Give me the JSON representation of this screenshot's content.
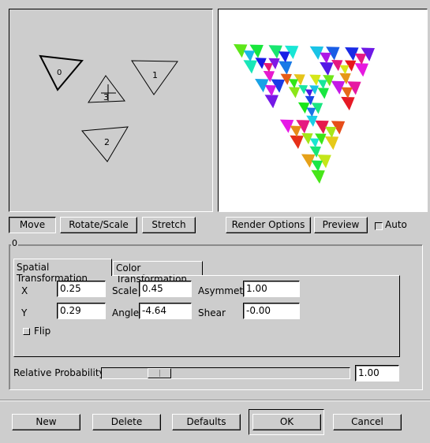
{
  "editor": {
    "triangles": [
      {
        "label": "0",
        "selected": true
      },
      {
        "label": "1"
      },
      {
        "label": "2"
      },
      {
        "label": "3"
      }
    ]
  },
  "toolbar": {
    "move": "Move",
    "rotate_scale": "Rotate/Scale",
    "stretch": "Stretch",
    "render_options": "Render Options",
    "preview": "Preview",
    "auto": "Auto",
    "auto_checked": false,
    "active_mode": "Move"
  },
  "group": {
    "title": "0"
  },
  "tabs": [
    {
      "label": "Spatial Transformation",
      "active": true
    },
    {
      "label": "Color Transformation"
    }
  ],
  "spatial": {
    "x_label": "X",
    "x": "0.25",
    "y_label": "Y",
    "y": "0.29",
    "scale_label": "Scale",
    "scale": "0.45",
    "angle_label": "Angle",
    "angle": "-4.64",
    "asym_label": "Asymmetry",
    "asym": "1.00",
    "shear_label": "Shear",
    "shear": "-0.00",
    "flip_label": "Flip",
    "flip": false
  },
  "probability": {
    "label": "Relative Probability:",
    "value": "1.00",
    "slider_fraction": 0.25
  },
  "footer": {
    "new": "New",
    "delete": "Delete",
    "defaults": "Defaults",
    "ok": "OK",
    "cancel": "Cancel"
  }
}
